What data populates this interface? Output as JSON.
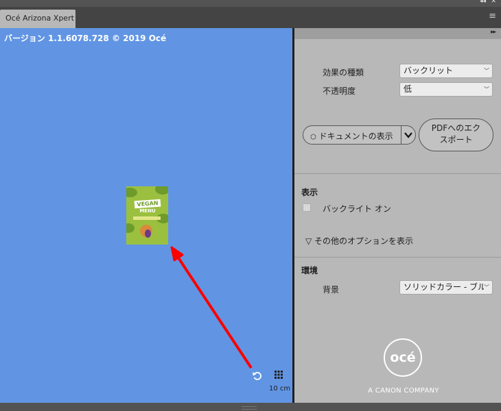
{
  "window": {
    "minimize_glyph": "◂◂",
    "close_glyph": "✕"
  },
  "tab": {
    "title": "Océ Arizona Xpert"
  },
  "canvas": {
    "version_text": "バージョン 1.1.6078.728 © 2019 Océ",
    "thumbnail": {
      "line1": "VEGAN",
      "line2": "MENU"
    },
    "scale_text": "10 cm",
    "colors": {
      "background": "#6195e4",
      "annotation_arrow": "#ff0000"
    }
  },
  "panel": {
    "expand_glyph": "▸▸",
    "effect_type": {
      "label": "効果の種類",
      "value": "バックリット"
    },
    "opacity": {
      "label": "不透明度",
      "value": "低"
    },
    "document_view_button": "ドキュメントの表示",
    "pdf_export_button": {
      "line1": "PDFへのエク",
      "line2": "スポート"
    },
    "display_section": {
      "title": "表示",
      "backlight_label": "バックライト オン",
      "backlight_checked": false
    },
    "more_options": "▽ その他のオプションを表示",
    "environment_section": {
      "title": "環境",
      "background_label": "背景",
      "background_value": "ソリッドカラー - ブル"
    },
    "brand": {
      "logo_text": "océ",
      "company": "A CANON COMPANY"
    }
  }
}
